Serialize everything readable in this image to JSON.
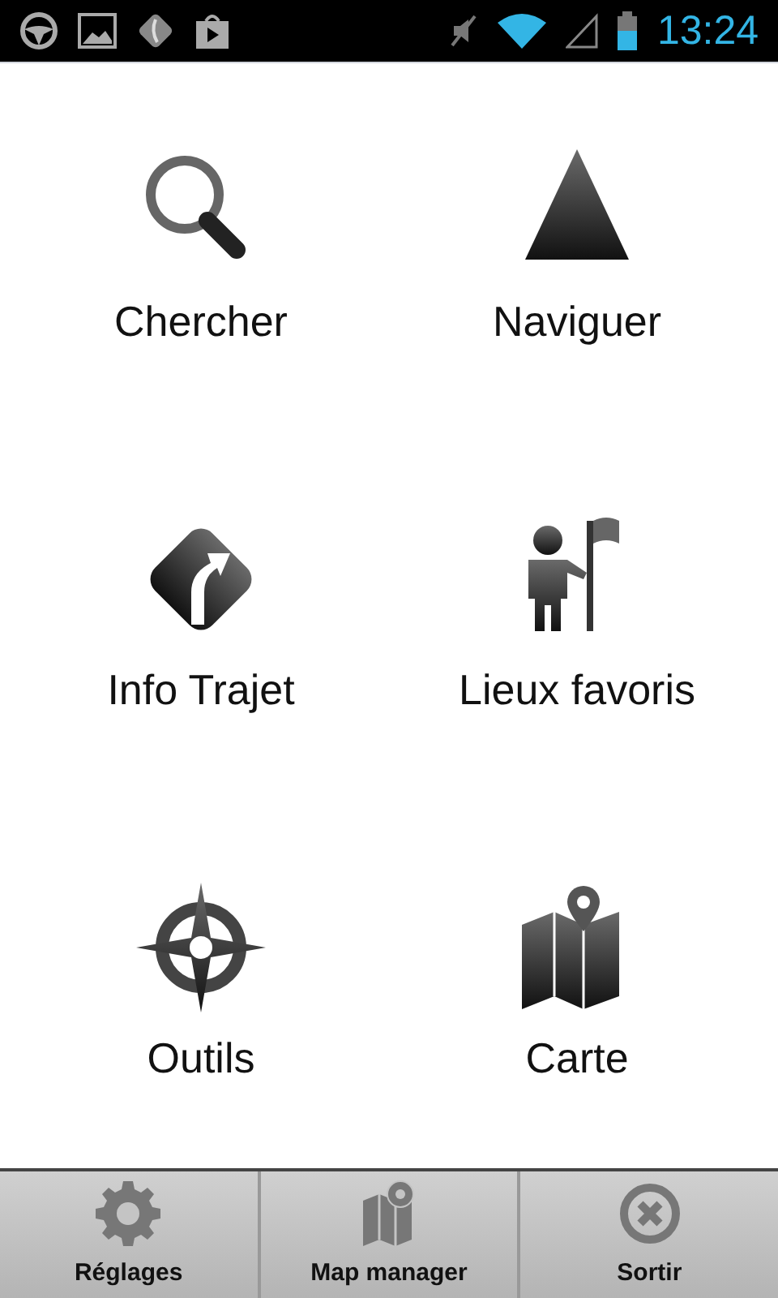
{
  "status_bar": {
    "time": "13:24"
  },
  "menu": [
    {
      "label": "Chercher",
      "kind": "search"
    },
    {
      "label": "Naviguer",
      "kind": "arrow"
    },
    {
      "label": "Info Trajet",
      "kind": "turn"
    },
    {
      "label": "Lieux favoris",
      "kind": "flag"
    },
    {
      "label": "Outils",
      "kind": "compass"
    },
    {
      "label": "Carte",
      "kind": "map"
    }
  ],
  "bottom_bar": [
    {
      "label": "Réglages",
      "kind": "gear"
    },
    {
      "label": "Map manager",
      "kind": "mapgear"
    },
    {
      "label": "Sortir",
      "kind": "close"
    }
  ]
}
